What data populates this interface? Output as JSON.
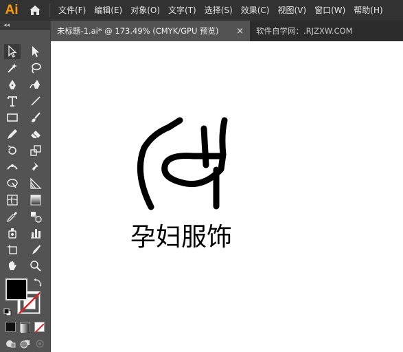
{
  "app": {
    "logo_text": "Ai"
  },
  "menu": [
    "文件(F)",
    "编辑(E)",
    "对象(O)",
    "文字(T)",
    "选择(S)",
    "效果(C)",
    "视图(V)",
    "窗口(W)",
    "帮助(H)"
  ],
  "tabs": {
    "active": {
      "title": "未标题-1.ai* @ 173.49% (CMYK/GPU 预览)",
      "close": "×"
    },
    "other": {
      "title": "软件自学网：.RJZXW.COM"
    }
  },
  "toolbox": {
    "collapse_glyph": "◂◂"
  },
  "artwork": {
    "text": "孕妇服饰"
  },
  "colors": {
    "fill": "#000000",
    "stroke": "#ffffff",
    "app_accent": "#ff9a00"
  }
}
